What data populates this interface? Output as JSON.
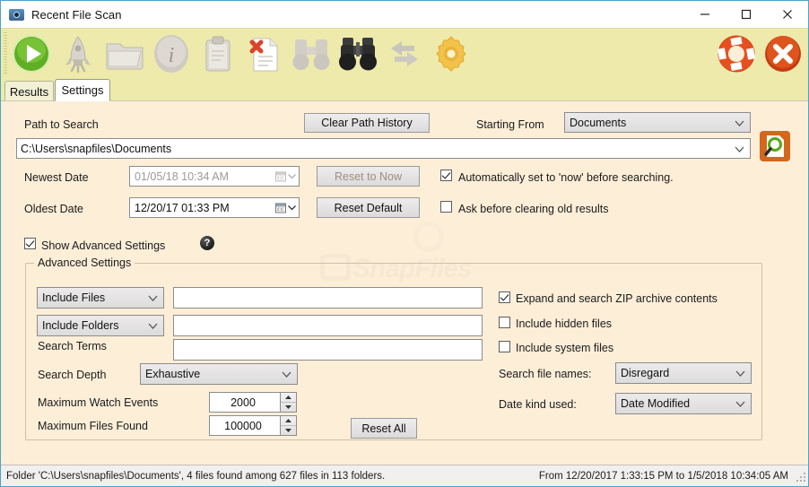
{
  "window": {
    "title": "Recent File Scan",
    "icon": "camera-lens-icon",
    "minimize_label": "–",
    "maximize_label": "□",
    "close_label": "✕"
  },
  "toolbar": {
    "buttons": [
      {
        "name": "start-scan-button",
        "icon": "green-play-icon",
        "label": "Start"
      },
      {
        "name": "launch-button",
        "icon": "rocket-icon",
        "label": "Launch"
      },
      {
        "name": "open-folder-button",
        "icon": "folder-icon",
        "label": "Open Folder"
      },
      {
        "name": "info-button",
        "icon": "info-circle-icon",
        "label": "Info"
      },
      {
        "name": "clipboard-button",
        "icon": "clipboard-icon",
        "label": "Clipboard"
      },
      {
        "name": "clear-results-button",
        "icon": "document-delete-icon",
        "label": "Clear Results"
      },
      {
        "name": "watch-disabled-button",
        "icon": "binoculars-gray-icon",
        "label": "Watch"
      },
      {
        "name": "watch-button",
        "icon": "binoculars-icon",
        "label": "Monitor"
      },
      {
        "name": "swap-button",
        "icon": "arrows-swap-icon",
        "label": "Swap"
      },
      {
        "name": "options-button",
        "icon": "gear-icon",
        "label": "Options"
      },
      {
        "name": "help-button",
        "icon": "life-ring-icon",
        "label": "Help"
      },
      {
        "name": "exit-button",
        "icon": "red-close-circle-icon",
        "label": "Exit"
      }
    ]
  },
  "tabs": [
    {
      "label": "Results",
      "active": false
    },
    {
      "label": "Settings",
      "active": true
    }
  ],
  "settings": {
    "path_label": "Path to Search",
    "clear_path_history_label": "Clear Path History",
    "starting_from_label": "Starting From",
    "starting_from_value": "Documents",
    "path_value": "C:\\Users\\snapfiles\\Documents",
    "search_button_icon": "magnifier-document-icon",
    "newest_date_label": "Newest Date",
    "newest_date_value": "01/05/18 10:34 AM",
    "reset_to_now_label": "Reset to Now",
    "oldest_date_label": "Oldest Date",
    "oldest_date_value": "12/20/17 01:33 PM",
    "reset_default_label": "Reset Default",
    "auto_now_label": "Automatically set to 'now' before searching.",
    "auto_now_checked": true,
    "ask_clear_label": "Ask before clearing old results",
    "ask_clear_checked": false,
    "show_advanced_label": "Show Advanced Settings",
    "show_advanced_checked": true,
    "help_glyph": "?"
  },
  "advanced": {
    "group_title": "Advanced Settings",
    "include_files_option": "Include Files",
    "include_files_value": "",
    "include_folders_option": "Include Folders",
    "include_folders_value": "",
    "search_terms_label": "Search Terms",
    "search_terms_value": "",
    "search_depth_label": "Search Depth",
    "search_depth_value": "Exhaustive",
    "max_watch_events_label": "Maximum Watch Events",
    "max_watch_events_value": "2000",
    "max_files_found_label": "Maximum Files Found",
    "max_files_found_value": "100000",
    "reset_all_label": "Reset All",
    "expand_zip_label": "Expand and search ZIP archive contents",
    "expand_zip_checked": true,
    "include_hidden_label": "Include hidden files",
    "include_hidden_checked": false,
    "include_system_label": "Include system files",
    "include_system_checked": false,
    "search_file_names_label": "Search file names:",
    "search_file_names_value": "Disregard",
    "date_kind_label": "Date kind used:",
    "date_kind_value": "Date Modified"
  },
  "statusbar": {
    "left": "Folder 'C:\\Users\\snapfiles\\Documents', 4 files found among 627 files in 113 folders.",
    "right": "From 12/20/2017 1:33:15 PM to 1/5/2018 10:34:05 AM"
  },
  "watermark": {
    "text": "SnapFiles"
  },
  "colors": {
    "toolbar_bg": "#edeaab",
    "content_bg": "#fdeed8",
    "accent_orange": "#d3671c",
    "play_green": "#4fa81e",
    "window_border": "#4aa3c7"
  }
}
